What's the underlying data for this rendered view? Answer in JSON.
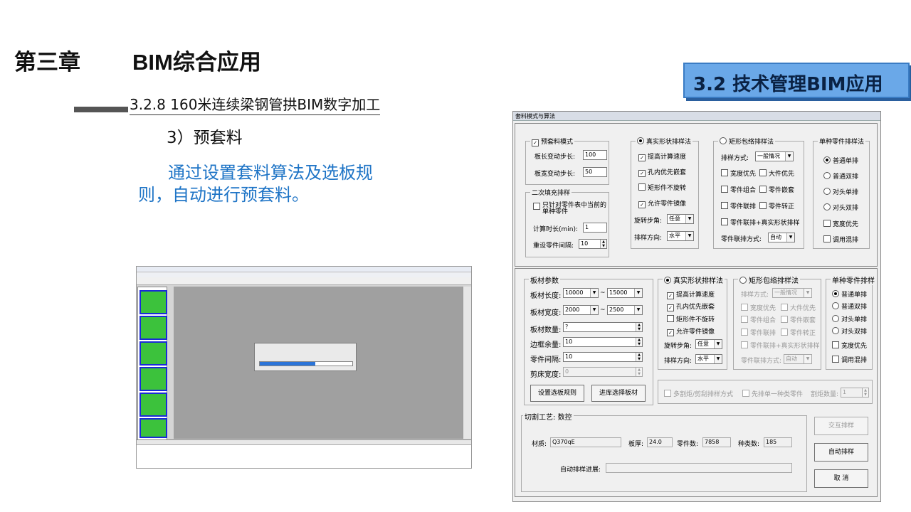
{
  "slide": {
    "chapter": "第三章",
    "chapter_title": "BIM综合应用",
    "section": "3.2 技术管理BIM应用",
    "subsection": "3.2.8 160米连续梁钢管拱BIM数字加工",
    "step": "3）预套料",
    "description": "通过设置套料算法及选板规则，自动进行预套料。"
  },
  "dialog": {
    "title": "套料模式与算法",
    "top": {
      "pre_nesting": {
        "label": "预套料模式",
        "length_step_label": "板长变动步长:",
        "length_step": "100",
        "width_step_label": "板宽变动步长:",
        "width_step": "50"
      },
      "refill": {
        "label": "二次填充排样",
        "only_current": "只针对零件表中当前的单种零件",
        "calc_time_label": "计算时长(min):",
        "calc_time": "1",
        "reset_gap_label": "重设零件间隔:",
        "reset_gap": "10"
      },
      "true_shape": {
        "label": "真实形状排样法",
        "opt1": "提高计算速度",
        "opt2": "孔内优先嵌套",
        "opt3": "矩形件不旋转",
        "opt4": "允许零件镜像",
        "rotate_label": "旋转步角:",
        "rotate_value": "任意",
        "direction_label": "排样方向:",
        "direction_value": "水平"
      },
      "rect": {
        "label": "矩形包络排样法",
        "mode_label": "排样方式:",
        "mode_value": "一般情况",
        "o1": "宽度优先",
        "o2": "大件优先",
        "o3": "零件组合",
        "o4": "零件嵌套",
        "o5": "零件联排",
        "o6": "零件转正",
        "o7": "零件联排+真实形状排样",
        "link_label": "零件联排方式:",
        "link_value": "自动"
      },
      "single": {
        "label": "单种零件排样法",
        "r1": "普通单排",
        "r2": "普通双排",
        "r3": "对头单排",
        "r4": "对头双排",
        "c1": "宽度优先",
        "c2": "调用混排"
      }
    },
    "bottom": {
      "plate": {
        "label": "板材参数",
        "length_label": "板材长度:",
        "length_from": "10000",
        "length_to": "15000",
        "width_label": "板材宽度:",
        "width_from": "2000",
        "width_to": "2500",
        "count_label": "板材数量:",
        "count": "?",
        "margin_label": "边框余量:",
        "margin": "10",
        "gap_label": "零件间隔:",
        "gap": "10",
        "shear_label": "剪床宽度:",
        "shear": "0",
        "tilde": "~"
      },
      "true_shape": {
        "label": "真实形状排样法",
        "opt1": "提高计算速度",
        "opt2": "孔内优先嵌套",
        "opt3": "矩形件不旋转",
        "opt4": "允许零件镜像",
        "rotate_label": "旋转步角:",
        "rotate_value": "任意",
        "direction_label": "排样方向:",
        "direction_value": "水平"
      },
      "rect": {
        "label": "矩形包络排样法",
        "mode_label": "排样方式:",
        "mode_value": "一般情况",
        "o1": "宽度优先",
        "o2": "大件优先",
        "o3": "零件组合",
        "o4": "零件嵌套",
        "o5": "零件联排",
        "o6": "零件转正",
        "o7": "零件联排+真实形状排样",
        "link_label": "零件联排方式:",
        "link_value": "自动"
      },
      "single": {
        "label": "单种零件排样",
        "r1": "普通单排",
        "r2": "普通双排",
        "r3": "对头单排",
        "r4": "对头双排",
        "c1": "宽度优先",
        "c2": "调用混排"
      },
      "btn_rule": "设置选板规则",
      "btn_stock": "进库选择板材",
      "multi_cut": "多割炬/剪刮排样方式",
      "first_single": "先排单一种类零件",
      "torch_label": "割炬数量:",
      "torch_value": "1",
      "cut_label": "切割工艺:",
      "cut_value": "数控",
      "material_label": "材质:",
      "material": "Q370qE",
      "thickness_label": "板厚:",
      "thickness": "24.0",
      "parts_label": "零件数:",
      "parts": "7858",
      "kinds_label": "种类数:",
      "kinds": "185",
      "progress_label": "自动排样进展:",
      "btn_interactive": "交互排样",
      "btn_auto": "自动排样",
      "btn_cancel": "取 消"
    }
  }
}
